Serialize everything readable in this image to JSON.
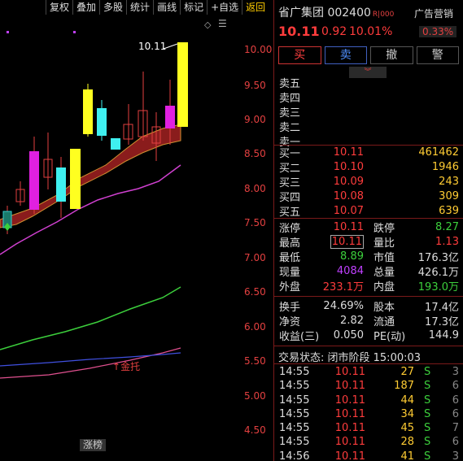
{
  "toolbar": {
    "items": [
      "复权",
      "叠加",
      "多股",
      "统计",
      "画线",
      "标记",
      "+自选",
      "返回"
    ]
  },
  "chart": {
    "price_axis": [
      "10.00",
      "9.50",
      "9.00",
      "8.50",
      "8.00",
      "7.50",
      "7.00",
      "6.50",
      "6.00",
      "5.50",
      "5.00",
      "4.50"
    ],
    "peak_label": "10.11",
    "gold_label": "金托",
    "zt_tag": "涨榜",
    "diamond": "◇",
    "collapse": "☰"
  },
  "chart_data": {
    "type": "candlestick",
    "y_axis_ticks": [
      10.0,
      9.5,
      9.0,
      8.5,
      8.0,
      7.5,
      7.0,
      6.5,
      6.0,
      5.5,
      5.0,
      4.5
    ],
    "last_high": 10.11
  },
  "stock": {
    "name": "省广集团 002400",
    "tag": "R|000",
    "price": "10.11",
    "change": "0.92",
    "pct": "10.01%",
    "ad_label": "广告营销",
    "ad_pct": "0.33%"
  },
  "trade_buttons": [
    "买",
    "卖",
    "撤",
    "警"
  ],
  "dropdown_icon": "︾",
  "asks": [
    {
      "label": "卖五",
      "price": "",
      "vol": ""
    },
    {
      "label": "卖四",
      "price": "",
      "vol": ""
    },
    {
      "label": "卖三",
      "price": "",
      "vol": ""
    },
    {
      "label": "卖二",
      "price": "",
      "vol": ""
    },
    {
      "label": "卖一",
      "price": "",
      "vol": ""
    }
  ],
  "bids": [
    {
      "label": "买一",
      "price": "10.11",
      "vol": "461462"
    },
    {
      "label": "买二",
      "price": "10.10",
      "vol": "1946"
    },
    {
      "label": "买三",
      "price": "10.09",
      "vol": "243"
    },
    {
      "label": "买四",
      "price": "10.08",
      "vol": "309"
    },
    {
      "label": "买五",
      "price": "10.07",
      "vol": "639"
    }
  ],
  "stats1": [
    {
      "l1": "涨停",
      "v1": "10.11",
      "c1": "red",
      "l2": "跌停",
      "v2": "8.27",
      "c2": "green"
    },
    {
      "l1": "最高",
      "v1": "10.11",
      "c1": "red boxed",
      "l2": "量比",
      "v2": "1.13",
      "c2": "red"
    },
    {
      "l1": "最低",
      "v1": "8.89",
      "c1": "green",
      "l2": "市值",
      "v2": "176.3亿",
      "c2": "white"
    },
    {
      "l1": "现量",
      "v1": "4084",
      "c1": "purple",
      "l2": "总量",
      "v2": "426.1万",
      "c2": "white"
    },
    {
      "l1": "外盘",
      "v1": "233.1万",
      "c1": "red",
      "l2": "内盘",
      "v2": "193.0万",
      "c2": "green"
    }
  ],
  "stats2": [
    {
      "l1": "换手",
      "v1": "24.69%",
      "c1": "white",
      "l2": "股本",
      "v2": "17.4亿",
      "c2": "white"
    },
    {
      "l1": "净资",
      "v1": "2.82",
      "c1": "white",
      "l2": "流通",
      "v2": "17.3亿",
      "c2": "white"
    },
    {
      "l1": "收益(三)",
      "v1": "0.050",
      "c1": "white",
      "l2": "PE(动)",
      "v2": "144.9",
      "c2": "white"
    }
  ],
  "trade_state": "交易状态: 闭市阶段 15:00:03",
  "ticks": [
    {
      "time": "14:55",
      "price": "10.11",
      "vol": "27",
      "side": "S",
      "cnt": "3"
    },
    {
      "time": "14:55",
      "price": "10.11",
      "vol": "187",
      "side": "S",
      "cnt": "6"
    },
    {
      "time": "14:55",
      "price": "10.11",
      "vol": "44",
      "side": "S",
      "cnt": "6"
    },
    {
      "time": "14:55",
      "price": "10.11",
      "vol": "34",
      "side": "S",
      "cnt": "6"
    },
    {
      "time": "14:55",
      "price": "10.11",
      "vol": "45",
      "side": "S",
      "cnt": "7"
    },
    {
      "time": "14:55",
      "price": "10.11",
      "vol": "28",
      "side": "S",
      "cnt": "6"
    },
    {
      "time": "14:56",
      "price": "10.11",
      "vol": "41",
      "side": "S",
      "cnt": "3"
    }
  ],
  "colors": {
    "up": "#ff3c3c",
    "down": "#3ccf3c",
    "accent": "#ffcc33"
  }
}
